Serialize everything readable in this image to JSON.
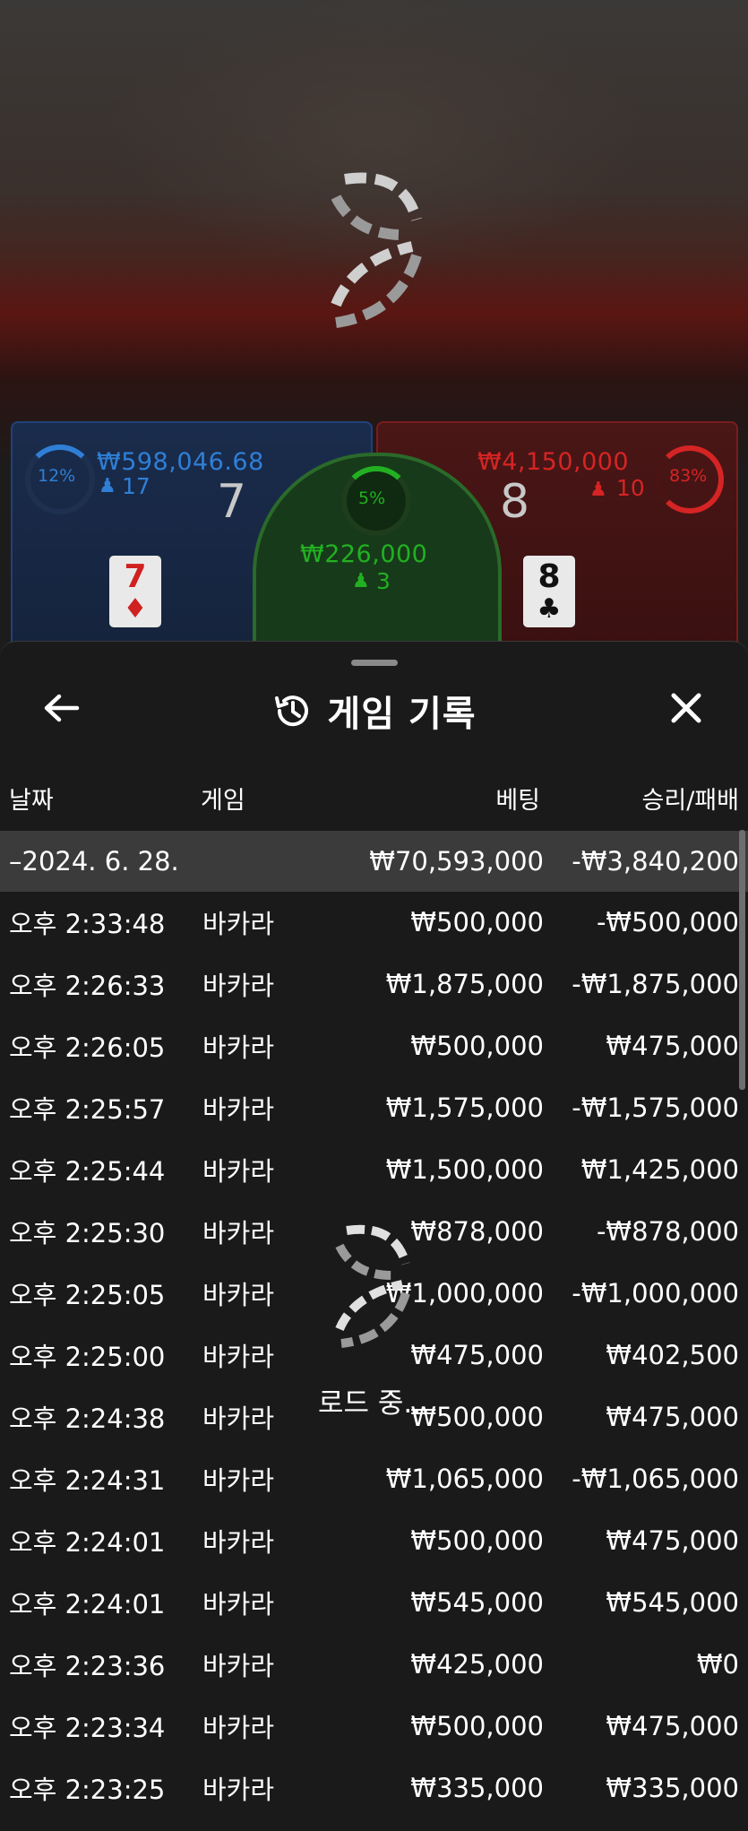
{
  "game": {
    "player": {
      "percent": "12%",
      "amount": "₩598,046.68",
      "count": "17",
      "score": "7",
      "card_rank": "7",
      "card_suit": "♦"
    },
    "tie": {
      "percent": "5%",
      "amount": "₩226,000",
      "count": "3"
    },
    "banker": {
      "percent": "83%",
      "amount": "₩4,150,000",
      "count": "10",
      "score": "8",
      "card_rank": "8",
      "card_suit": "♣"
    }
  },
  "sheet": {
    "title": "게임 기록",
    "columns": {
      "date": "날짜",
      "game": "게임",
      "bet": "베팅",
      "win": "승리/패배"
    },
    "summary": {
      "date": "–2024. 6. 28.",
      "bet": "₩70,593,000",
      "win": "-₩3,840,200"
    },
    "rows": [
      {
        "time": "오후 2:33:48",
        "game": "바카라",
        "bet": "₩500,000",
        "win": "-₩500,000"
      },
      {
        "time": "오후 2:26:33",
        "game": "바카라",
        "bet": "₩1,875,000",
        "win": "-₩1,875,000"
      },
      {
        "time": "오후 2:26:05",
        "game": "바카라",
        "bet": "₩500,000",
        "win": "₩475,000"
      },
      {
        "time": "오후 2:25:57",
        "game": "바카라",
        "bet": "₩1,575,000",
        "win": "-₩1,575,000"
      },
      {
        "time": "오후 2:25:44",
        "game": "바카라",
        "bet": "₩1,500,000",
        "win": "₩1,425,000"
      },
      {
        "time": "오후 2:25:30",
        "game": "바카라",
        "bet": "₩878,000",
        "win": "-₩878,000"
      },
      {
        "time": "오후 2:25:05",
        "game": "바카라",
        "bet": "₩1,000,000",
        "win": "-₩1,000,000"
      },
      {
        "time": "오후 2:25:00",
        "game": "바카라",
        "bet": "₩475,000",
        "win": "₩402,500"
      },
      {
        "time": "오후 2:24:38",
        "game": "바카라",
        "bet": "₩500,000",
        "win": "₩475,000"
      },
      {
        "time": "오후 2:24:31",
        "game": "바카라",
        "bet": "₩1,065,000",
        "win": "-₩1,065,000"
      },
      {
        "time": "오후 2:24:01",
        "game": "바카라",
        "bet": "₩500,000",
        "win": "₩475,000"
      },
      {
        "time": "오후 2:24:01",
        "game": "바카라",
        "bet": "₩545,000",
        "win": "₩545,000"
      },
      {
        "time": "오후 2:23:36",
        "game": "바카라",
        "bet": "₩425,000",
        "win": "₩0"
      },
      {
        "time": "오후 2:23:34",
        "game": "바카라",
        "bet": "₩500,000",
        "win": "₩475,000"
      },
      {
        "time": "오후 2:23:25",
        "game": "바카라",
        "bet": "₩335,000",
        "win": "₩335,000"
      }
    ],
    "loading_text": "로드 중..."
  },
  "colors": {
    "player": "#2f7fd6",
    "banker": "#d62424",
    "tie": "#22b022"
  }
}
